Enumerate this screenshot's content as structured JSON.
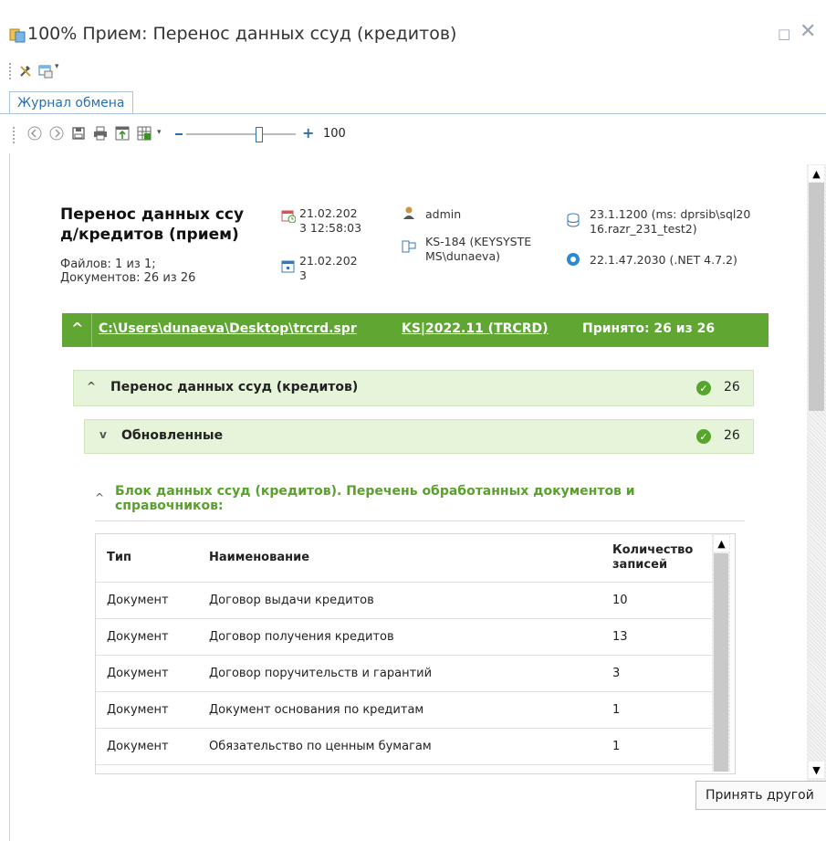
{
  "window": {
    "title": "100% Прием: Перенос данных ссуд (кредитов)",
    "maximize_glyph": "□",
    "close_glyph": "✕"
  },
  "tabs": [
    {
      "label": "Журнал обмена",
      "active": true
    }
  ],
  "toolbar": {
    "zoom_value": "100"
  },
  "report": {
    "title": "Перенос данных ссуд/кредитов (прием)",
    "title_line1": "Перенос данных ссу",
    "title_line2": "д/кредитов (прием)",
    "files": "Файлов: 1 из 1;",
    "documents": "Документов: 26 из 26",
    "date1_line1": "21.02.202",
    "date1_line2": "3 12:58:03",
    "date2_line1": "21.02.202",
    "date2_line2": "3",
    "user": "admin",
    "machine_line1": "KS-184 (KEYSYSTE",
    "machine_line2": "MS\\dunaeva)",
    "db_line1": "23.1.1200 (ms: dprsib\\sql20",
    "db_line2": "16.razr_231_test2)",
    "version": "22.1.47.2030 (.NET 4.7.2)"
  },
  "file_bar": {
    "path": "C:\\Users\\dunaeva\\Desktop\\trcrd.spr",
    "format": "KS|2022.11 (TRCRD)",
    "accepted": "Принято: 26 из 26",
    "color": "#5fa632"
  },
  "sections": [
    {
      "label": "Перенос данных ссуд (кредитов)",
      "count": "26",
      "chevron": "^"
    },
    {
      "label": "Обновленные",
      "count": "26",
      "chevron": "v"
    }
  ],
  "block": {
    "title": "Блок данных ссуд (кредитов). Перечень обработанных документов и справочников:",
    "title_color": "#5aa02c"
  },
  "table": {
    "headers": {
      "type": "Тип",
      "name": "Наименование",
      "count_line1": "Количество",
      "count_line2": "записей"
    },
    "rows": [
      {
        "type": "Документ",
        "name": "Договор выдачи кредитов",
        "count": "10"
      },
      {
        "type": "Документ",
        "name": "Договор получения кредитов",
        "count": "13"
      },
      {
        "type": "Документ",
        "name": "Договор поручительств и гарантий",
        "count": "3"
      },
      {
        "type": "Документ",
        "name": "Документ основания по кредитам",
        "count": "1"
      },
      {
        "type": "Документ",
        "name": "Обязательство по ценным бумагам",
        "count": "1"
      }
    ]
  },
  "buttons": {
    "accept_other": "Принять другой"
  },
  "icons": [
    "app-icon",
    "tools-icon",
    "window-icon",
    "back-icon",
    "forward-icon",
    "save-icon",
    "print-icon",
    "export-icon",
    "table-export-icon",
    "zoom-out-icon",
    "zoom-in-icon",
    "calendar-icon",
    "user-icon",
    "computer-icon",
    "database-icon",
    "version-icon",
    "check-icon"
  ]
}
